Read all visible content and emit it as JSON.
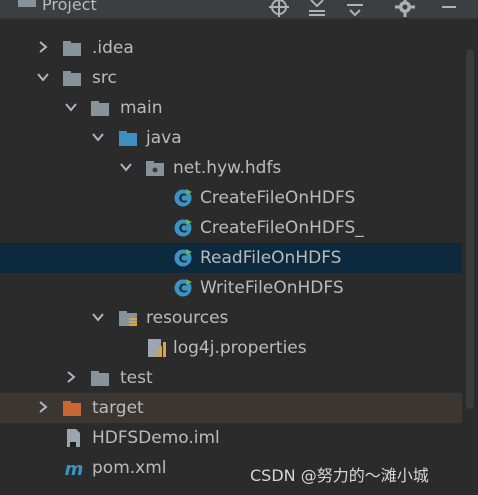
{
  "header": {
    "title": "Project",
    "icons": [
      "target-icon",
      "collapse-icon",
      "expand-icon",
      "gear-icon"
    ]
  },
  "tree": {
    "items": [
      {
        "label": ".idea",
        "type": "folder",
        "expanded": false
      },
      {
        "label": "src",
        "type": "folder",
        "expanded": true
      },
      {
        "label": "main",
        "type": "folder",
        "expanded": true
      },
      {
        "label": "java",
        "type": "source-folder",
        "expanded": true
      },
      {
        "label": "net.hyw.hdfs",
        "type": "package",
        "expanded": true
      },
      {
        "label": "CreateFileOnHDFS",
        "type": "class"
      },
      {
        "label": "CreateFileOnHDFS_",
        "type": "class"
      },
      {
        "label": "ReadFileOnHDFS",
        "type": "class",
        "selected": true
      },
      {
        "label": "WriteFileOnHDFS",
        "type": "class"
      },
      {
        "label": "resources",
        "type": "resources-folder",
        "expanded": true
      },
      {
        "label": "log4j.properties",
        "type": "properties-file"
      },
      {
        "label": "test",
        "type": "folder",
        "expanded": false
      },
      {
        "label": "target",
        "type": "excluded-folder",
        "expanded": false
      },
      {
        "label": "HDFSDemo.iml",
        "type": "iml-file"
      },
      {
        "label": "pom.xml",
        "type": "maven-file"
      }
    ]
  },
  "watermark": "CSDN @努力的～滩小城",
  "colors": {
    "background": "#2b2b2b",
    "selection": "#0d293e",
    "folder": "#87939a",
    "source_folder": "#3d8fc2",
    "excluded_folder": "#c96634",
    "class_icon": "#3b93c4"
  }
}
